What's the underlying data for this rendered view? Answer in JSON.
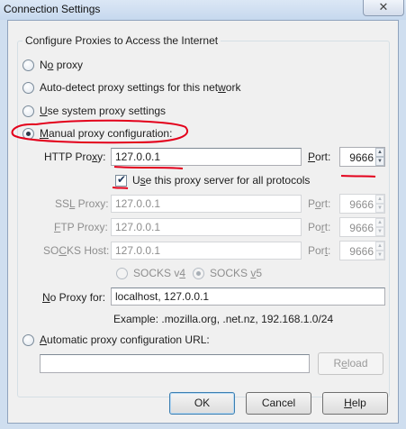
{
  "window": {
    "title": "Connection Settings",
    "close_glyph": "✕"
  },
  "group": {
    "title": "Configure Proxies to Access the Internet"
  },
  "options": {
    "no_proxy": {
      "pre": "N",
      "ul": "o",
      "post": " proxy"
    },
    "auto_detect": {
      "pre": "Auto-detect proxy settings for this net",
      "ul": "w",
      "post": "ork"
    },
    "system": {
      "pre": "",
      "ul": "U",
      "post": "se system proxy settings"
    },
    "manual": {
      "pre": "",
      "ul": "M",
      "post": "anual proxy configuration:"
    },
    "pac": {
      "pre": "",
      "ul": "A",
      "post": "utomatic proxy configuration URL:"
    }
  },
  "http": {
    "label_pre": "HTTP Pro",
    "label_ul": "x",
    "label_post": "y:",
    "host": "127.0.0.1",
    "port_label_pre": "",
    "port_label_ul": "P",
    "port_label_post": "ort:",
    "port": "9666"
  },
  "use_for_all": {
    "pre": "U",
    "ul": "s",
    "post": "e this proxy server for all protocols",
    "checked": true
  },
  "ssl": {
    "label_pre": "SS",
    "label_ul": "L",
    "label_post": " Proxy:",
    "host": "127.0.0.1",
    "port_label_pre": "P",
    "port_label_ul": "o",
    "port_label_post": "rt:",
    "port": "9666"
  },
  "ftp": {
    "label_pre": "",
    "label_ul": "F",
    "label_post": "TP Proxy:",
    "host": "127.0.0.1",
    "port_label_pre": "Po",
    "port_label_ul": "r",
    "port_label_post": "t:",
    "port": "9666"
  },
  "socks": {
    "label_pre": "SO",
    "label_ul": "C",
    "label_post": "KS Host:",
    "host": "127.0.0.1",
    "port_label_pre": "Por",
    "port_label_ul": "t",
    "port_label_post": ":",
    "port": "9666"
  },
  "socks_version": {
    "v4": {
      "pre": "SOCKS v",
      "ul": "4",
      "post": ""
    },
    "v5": {
      "pre": "SOCKS ",
      "ul": "v",
      "post": "5"
    }
  },
  "no_proxy_for": {
    "label_pre": "",
    "label_ul": "N",
    "label_post": "o Proxy for:",
    "value": "localhost, 127.0.0.1",
    "example": "Example: .mozilla.org, .net.nz, 192.168.1.0/24"
  },
  "pac_url": {
    "value": ""
  },
  "buttons": {
    "reload": {
      "pre": "R",
      "ul": "e",
      "post": "load"
    },
    "ok": "OK",
    "cancel": "Cancel",
    "help": {
      "pre": "",
      "ul": "H",
      "post": "elp"
    }
  },
  "spinner": {
    "up": "▲",
    "down": "▼"
  },
  "check_glyph": "✔",
  "colors": {
    "annotation": "#e3001b"
  }
}
